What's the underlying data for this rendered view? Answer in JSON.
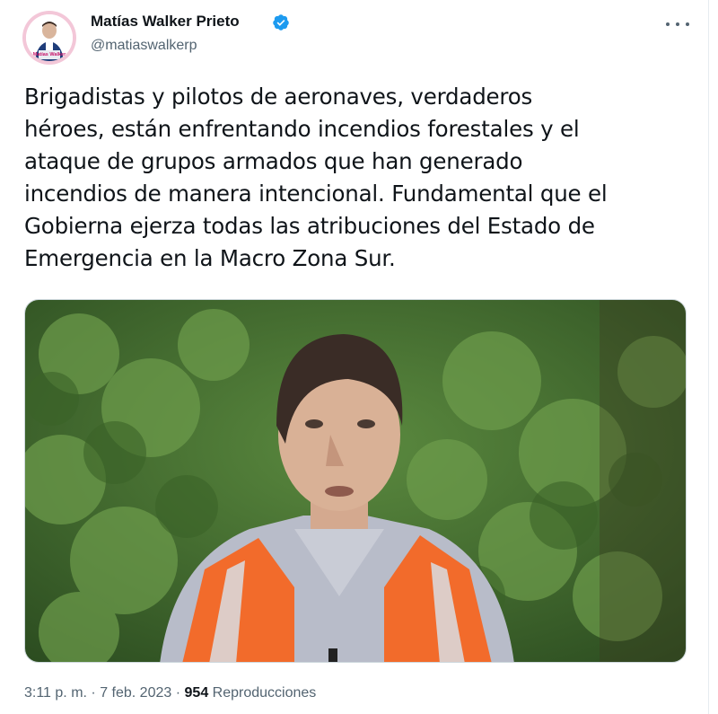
{
  "author": {
    "name": "Matías Walker Prieto",
    "handle": "@matiaswalkerp",
    "verified": true,
    "avatar_badge_text": "Matías Walker",
    "avatar_ring_color": "#f3c7d8"
  },
  "tweet": {
    "text": "Brigadistas y pilotos de aeronaves, verdaderos\nhéroes, están enfrentando incendios forestales y el\nataque de grupos armados que han generado\nincendios de manera intencional. Fundamental que el\nGobierna ejerza todas las atribuciones del Estado de\nEmergencia en la Macro Zona Sur."
  },
  "media": {
    "type": "video",
    "subject": "man in orange safety vest in front of green foliage"
  },
  "meta": {
    "time": "3:11 p. m.",
    "separator": "·",
    "date": "7 feb. 2023",
    "views_count": "954",
    "views_label": "Reproducciones"
  },
  "icons": {
    "verified": "verified-badge-icon",
    "more": "more-options-icon"
  },
  "colors": {
    "text_primary": "#0f1419",
    "text_secondary": "#536471",
    "verified_blue": "#1d9bf0",
    "vest_orange": "#f26b2b",
    "foliage_green": "#3f6b2e"
  }
}
